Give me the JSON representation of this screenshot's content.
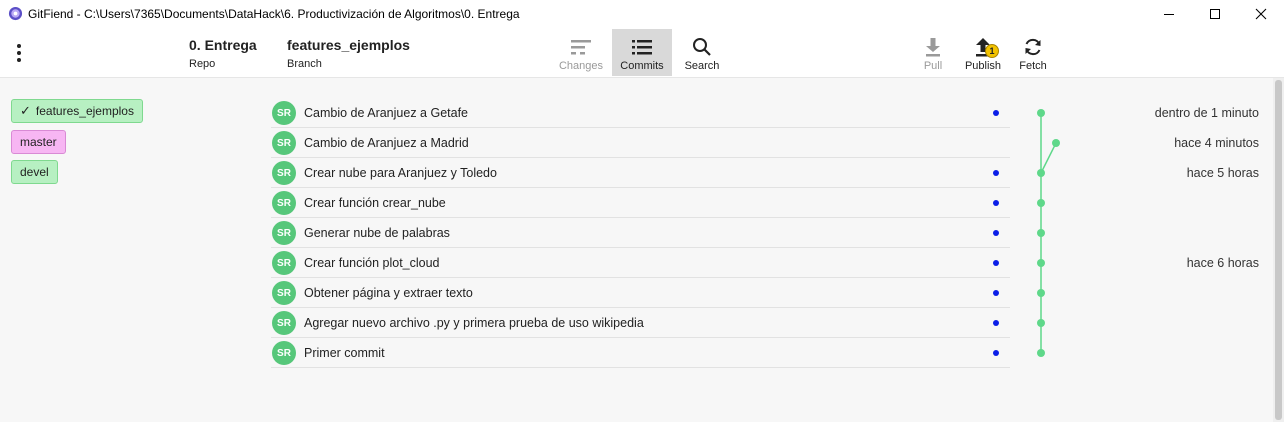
{
  "window": {
    "title": "GitFiend - C:\\Users\\7365\\Documents\\DataHack\\6. Productivización de Algoritmos\\0. Entrega"
  },
  "toolbar": {
    "repo_value": "0. Entrega",
    "repo_label": "Repo",
    "branch_value": "features_ejemplos",
    "branch_label": "Branch",
    "changes_label": "Changes",
    "commits_label": "Commits",
    "search_label": "Search",
    "pull_label": "Pull",
    "publish_label": "Publish",
    "publish_badge": "1",
    "fetch_label": "Fetch"
  },
  "branches": [
    {
      "name": "features_ejemplos",
      "checked_mark": "✓",
      "color": "#b7f0c2"
    },
    {
      "name": "master",
      "color": "#f7b6f3"
    },
    {
      "name": "devel",
      "color": "#b7f0c2"
    }
  ],
  "commits": [
    {
      "author_initials": "SR",
      "message": "Cambio de Aranjuez a Getafe",
      "unpushed": true,
      "time": "dentro de 1 minuto"
    },
    {
      "author_initials": "SR",
      "message": "Cambio de Aranjuez a Madrid",
      "unpushed": false,
      "time": "hace 4 minutos"
    },
    {
      "author_initials": "SR",
      "message": "Crear nube para Aranjuez y Toledo",
      "unpushed": true,
      "time": "hace 5 horas"
    },
    {
      "author_initials": "SR",
      "message": "Crear función crear_nube",
      "unpushed": true,
      "time": ""
    },
    {
      "author_initials": "SR",
      "message": "Generar nube de palabras",
      "unpushed": true,
      "time": ""
    },
    {
      "author_initials": "SR",
      "message": "Crear función plot_cloud",
      "unpushed": true,
      "time": "hace 6 horas"
    },
    {
      "author_initials": "SR",
      "message": "Obtener página y extraer texto",
      "unpushed": true,
      "time": ""
    },
    {
      "author_initials": "SR",
      "message": "Agregar nuevo archivo .py y primera prueba de uso wikipedia",
      "unpushed": true,
      "time": ""
    },
    {
      "author_initials": "SR",
      "message": "Primer commit",
      "unpushed": true,
      "time": ""
    }
  ],
  "colors": {
    "graph_line": "#5fd88a",
    "unpushed_dot": "#0a1ee8",
    "avatar": "#56c77a",
    "badge": "#f2c200"
  },
  "icons": [
    "app-logo-icon",
    "minimize-icon",
    "maximize-icon",
    "close-icon",
    "kebab-menu-icon",
    "changes-icon",
    "commits-list-icon",
    "search-icon",
    "pull-icon",
    "publish-icon",
    "fetch-icon",
    "checkmark-icon"
  ]
}
